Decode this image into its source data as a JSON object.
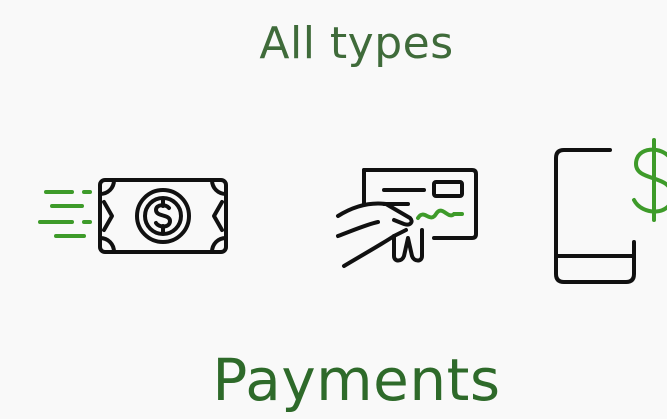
{
  "header": {
    "subtitle": "All types"
  },
  "payment_methods": [
    {
      "name": "cash",
      "icon": "cash-payment-icon"
    },
    {
      "name": "check",
      "icon": "check-payment-icon"
    },
    {
      "name": "mobile",
      "icon": "mobile-payment-icon"
    }
  ],
  "footer": {
    "title": "Payments"
  },
  "colors": {
    "background": "#f9f9f9",
    "text_green": "#3f6b3a",
    "title_green": "#2e6a2a",
    "accent_green": "#3e9b2a",
    "stroke_black": "#111111"
  }
}
